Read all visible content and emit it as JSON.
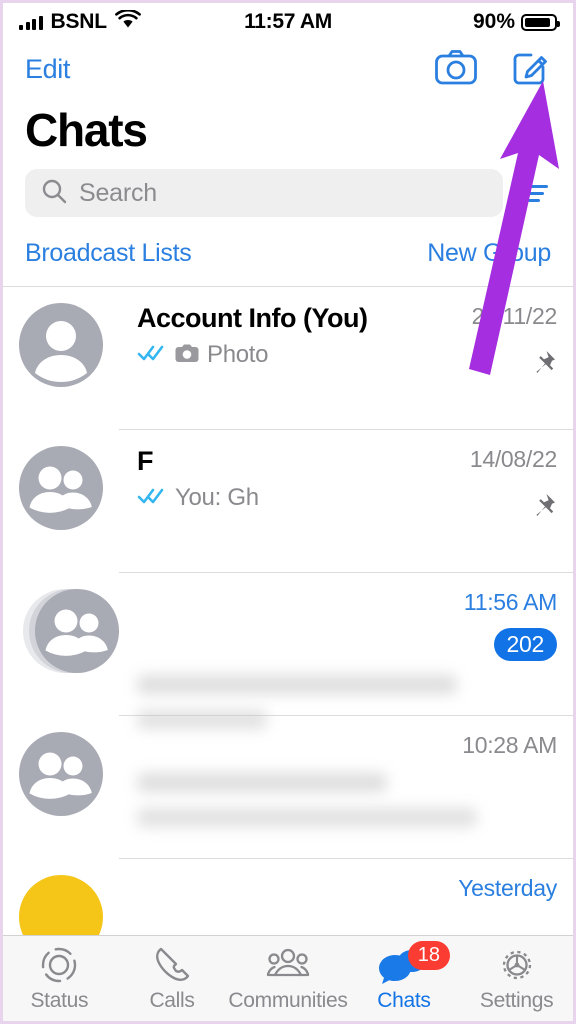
{
  "status_bar": {
    "carrier": "BSNL",
    "time": "11:57 AM",
    "battery_percent": "90%",
    "signal_icon": "signal-bars-icon",
    "wifi_icon": "wifi-icon",
    "battery_icon": "battery-icon"
  },
  "nav": {
    "edit_label": "Edit",
    "camera_icon": "camera-icon",
    "compose_icon": "compose-icon"
  },
  "header": {
    "title": "Chats"
  },
  "search": {
    "placeholder": "Search",
    "search_icon": "search-icon",
    "filter_icon": "filter-icon"
  },
  "links": {
    "broadcast_lists": "Broadcast Lists",
    "new_group": "New Group"
  },
  "colors": {
    "ios_blue": "#2b7fe0",
    "badge_blue": "#1273e6",
    "badge_red": "#fa3c32",
    "avatar_gray": "#a8aab4",
    "separator": "#dcdcdc",
    "search_bg": "#efeff0",
    "tabbar_bg": "#f7f7f7",
    "arrow_purple": "#a42ee0"
  },
  "chats": [
    {
      "name": "Account Info (You)",
      "avatar": "single-person",
      "ticks": "read-double-check",
      "attachment_icon": "camera-icon",
      "preview": "Photo",
      "timestamp": "26/11/22",
      "timestamp_unread": false,
      "pinned": true,
      "unread_count": "",
      "redacted": false
    },
    {
      "name": "F",
      "avatar": "group",
      "ticks": "read-double-check",
      "attachment_icon": "",
      "preview": "You: Gh",
      "timestamp": "14/08/22",
      "timestamp_unread": false,
      "pinned": true,
      "unread_count": "",
      "redacted": false
    },
    {
      "name": "",
      "avatar": "group-stacked",
      "ticks": "",
      "attachment_icon": "",
      "preview": "",
      "timestamp": "11:56 AM",
      "timestamp_unread": true,
      "pinned": false,
      "unread_count": "202",
      "redacted": true
    },
    {
      "name": "",
      "avatar": "group",
      "ticks": "",
      "attachment_icon": "",
      "preview": "",
      "timestamp": "10:28 AM",
      "timestamp_unread": false,
      "pinned": false,
      "unread_count": "",
      "redacted": true
    },
    {
      "name": "",
      "avatar": "yellow",
      "ticks": "",
      "attachment_icon": "",
      "preview": "",
      "timestamp": "Yesterday",
      "timestamp_unread": true,
      "pinned": false,
      "unread_count": "",
      "redacted": true
    }
  ],
  "tabs": [
    {
      "label": "Status",
      "icon": "status-rings-icon",
      "active": false,
      "badge": ""
    },
    {
      "label": "Calls",
      "icon": "phone-icon",
      "active": false,
      "badge": ""
    },
    {
      "label": "Communities",
      "icon": "communities-icon",
      "active": false,
      "badge": ""
    },
    {
      "label": "Chats",
      "icon": "chat-bubbles-icon",
      "active": true,
      "badge": "18"
    },
    {
      "label": "Settings",
      "icon": "gear-icon",
      "active": false,
      "badge": ""
    }
  ],
  "annotation": {
    "arrow_icon": "purple-arrow-pointing-to-compose-button"
  }
}
